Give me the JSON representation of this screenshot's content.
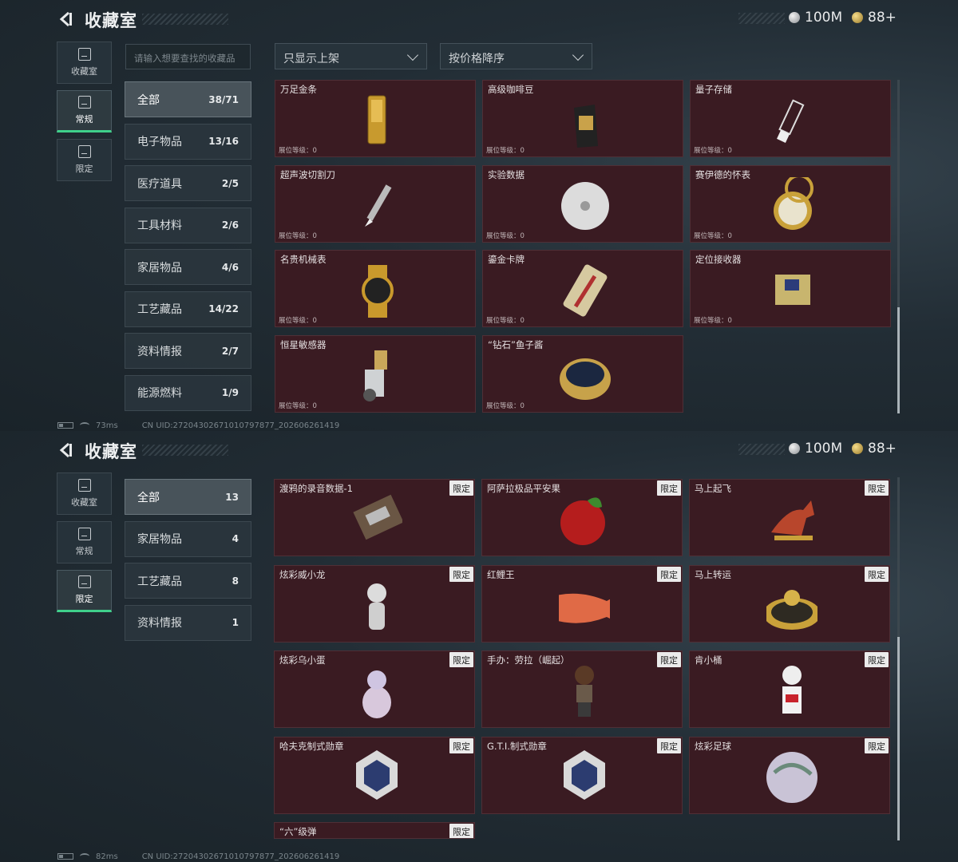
{
  "panels": [
    {
      "title": "收藏室",
      "currency": {
        "silver": "100M",
        "gold": "88+"
      },
      "nav": [
        {
          "label": "收藏室",
          "icon": "vault-icon"
        },
        {
          "label": "常规",
          "icon": "image-icon"
        },
        {
          "label": "限定",
          "icon": "picture-icon"
        }
      ],
      "active_nav": 1,
      "search_placeholder": "请输入想要查找的收藏品",
      "filter1": "只显示上架",
      "filter2": "按价格降序",
      "categories": [
        {
          "label": "全部",
          "count": "38/71"
        },
        {
          "label": "电子物品",
          "count": "13/16"
        },
        {
          "label": "医疗道具",
          "count": "2/5"
        },
        {
          "label": "工具材料",
          "count": "2/6"
        },
        {
          "label": "家居物品",
          "count": "4/6"
        },
        {
          "label": "工艺藏品",
          "count": "14/22"
        },
        {
          "label": "资料情报",
          "count": "2/7"
        },
        {
          "label": "能源燃料",
          "count": "1/9"
        }
      ],
      "items": [
        {
          "name": "万足金条",
          "level": "展位等级：0",
          "icon": "gold-bar-icon"
        },
        {
          "name": "高级咖啡豆",
          "level": "展位等级：0",
          "icon": "coffee-bag-icon"
        },
        {
          "name": "量子存储",
          "level": "展位等级：0",
          "icon": "usb-drive-icon"
        },
        {
          "name": "超声波切割刀",
          "level": "展位等级：0",
          "icon": "knife-icon"
        },
        {
          "name": "实验数据",
          "level": "展位等级：0",
          "icon": "disc-icon"
        },
        {
          "name": "赛伊德的怀表",
          "level": "展位等级：0",
          "icon": "pocket-watch-icon"
        },
        {
          "name": "名贵机械表",
          "level": "展位等级：0",
          "icon": "wristwatch-icon"
        },
        {
          "name": "鎏金卡牌",
          "level": "展位等级：0",
          "icon": "card-icon"
        },
        {
          "name": "定位接收器",
          "level": "展位等级：0",
          "icon": "receiver-icon"
        },
        {
          "name": "恒星敏感器",
          "level": "展位等级：0",
          "icon": "sensor-icon"
        },
        {
          "name": "“钻石”鱼子酱",
          "level": "展位等级：0",
          "icon": "caviar-tin-icon"
        }
      ],
      "status": {
        "ping": "73ms",
        "uid": "CN UID:27204302671010797877_202606261419"
      }
    },
    {
      "title": "收藏室",
      "currency": {
        "silver": "100M",
        "gold": "88+"
      },
      "nav": [
        {
          "label": "收藏室",
          "icon": "vault-icon"
        },
        {
          "label": "常规",
          "icon": "image-icon"
        },
        {
          "label": "限定",
          "icon": "picture-icon"
        }
      ],
      "active_nav": 2,
      "categories": [
        {
          "label": "全部",
          "count": "13"
        },
        {
          "label": "家居物品",
          "count": "4"
        },
        {
          "label": "工艺藏品",
          "count": "8"
        },
        {
          "label": "资料情报",
          "count": "1"
        }
      ],
      "tag": "限定",
      "items": [
        {
          "name": "渡鸦的录音数据-1",
          "icon": "cassette-icon"
        },
        {
          "name": "阿萨拉极品平安果",
          "icon": "apple-icon"
        },
        {
          "name": "马上起飞",
          "icon": "horse-icon"
        },
        {
          "name": "炫彩威小龙",
          "icon": "dragon-figure-icon"
        },
        {
          "name": "红鲤王",
          "icon": "carp-icon"
        },
        {
          "name": "马上转运",
          "icon": "compass-plate-icon"
        },
        {
          "name": "炫彩乌小蛋",
          "icon": "egg-figure-icon"
        },
        {
          "name": "手办：劳拉（崛起）",
          "icon": "figure-icon"
        },
        {
          "name": "肯小桶",
          "icon": "mascot-icon"
        },
        {
          "name": "哈夫克制式勋章",
          "icon": "medal-icon"
        },
        {
          "name": "G.T.I.制式勋章",
          "icon": "medal-icon"
        },
        {
          "name": "炫彩足球",
          "icon": "football-icon"
        },
        {
          "name": "“六”级弹",
          "icon": "bullet-icon"
        }
      ],
      "status": {
        "ping": "82ms",
        "uid": "CN UID:27204302671010797877_202606261419"
      }
    }
  ]
}
